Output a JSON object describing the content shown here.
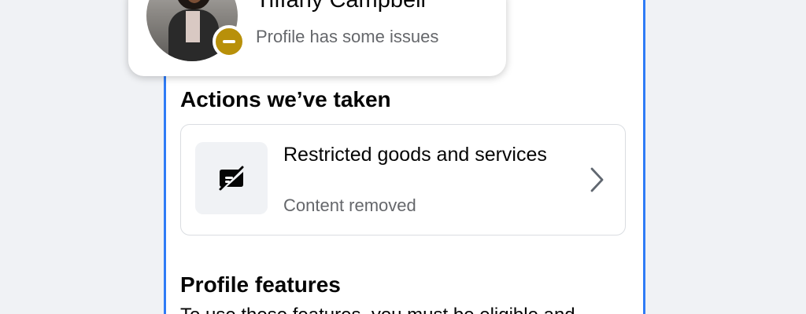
{
  "profile": {
    "name": "Tiffany Campbell",
    "status": "Profile has some issues",
    "status_color": "#b8900a"
  },
  "actions": {
    "title": "Actions we’ve taken",
    "items": [
      {
        "title": "Restricted goods and services",
        "subtitle": "Content removed",
        "icon": "restricted-card-icon"
      }
    ]
  },
  "features": {
    "title": "Profile features",
    "description": "To use these features, you must be eligible and"
  },
  "colors": {
    "accent": "#2f7cf6",
    "text_primary": "#050505",
    "text_secondary": "#65676b",
    "card_border": "#dadde1",
    "icon_bg": "#f0f2f5"
  }
}
